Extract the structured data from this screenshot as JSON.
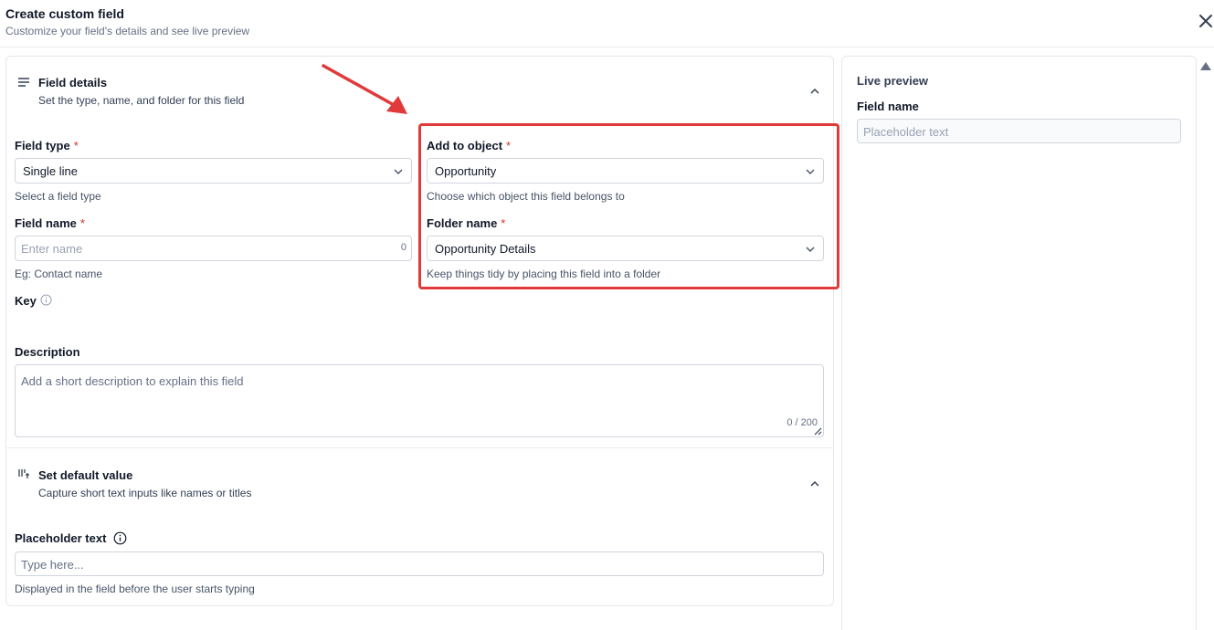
{
  "header": {
    "title": "Create custom field",
    "subtitle": "Customize your field's details and see live preview"
  },
  "field_details": {
    "title": "Field details",
    "subtitle": "Set the type, name, and folder for this field",
    "field_type": {
      "label": "Field type",
      "required_mark": "*",
      "value": "Single line",
      "help": "Select a field type"
    },
    "field_name": {
      "label": "Field name",
      "required_mark": "*",
      "placeholder": "Enter name",
      "count": "0",
      "help": "Eg: Contact name"
    },
    "add_to_object": {
      "label": "Add to object",
      "required_mark": "*",
      "value": "Opportunity",
      "help": "Choose which object this field belongs to"
    },
    "folder_name": {
      "label": "Folder name",
      "required_mark": "*",
      "value": "Opportunity Details",
      "help": "Keep things tidy by placing this field into a folder"
    },
    "key": {
      "label": "Key"
    },
    "description": {
      "label": "Description",
      "placeholder": "Add a short description to explain this field",
      "count": "0 / 200"
    }
  },
  "default_value": {
    "title": "Set default value",
    "subtitle": "Capture short text inputs like names or titles",
    "placeholder_text": {
      "label": "Placeholder text",
      "placeholder": "Type here...",
      "help": "Displayed in the field before the user starts typing"
    }
  },
  "live_preview": {
    "title": "Live preview",
    "field_label": "Field name",
    "input_placeholder": "Placeholder text"
  },
  "colors": {
    "highlight": "#e03a3a",
    "required": "#d92d20",
    "border": "#d0d5dd"
  },
  "icons": [
    "close-icon",
    "lines-icon",
    "chevron-up-icon",
    "chevron-down-icon",
    "info-icon",
    "default-value-icon",
    "annotation-arrow",
    "scroll-up-icon"
  ]
}
